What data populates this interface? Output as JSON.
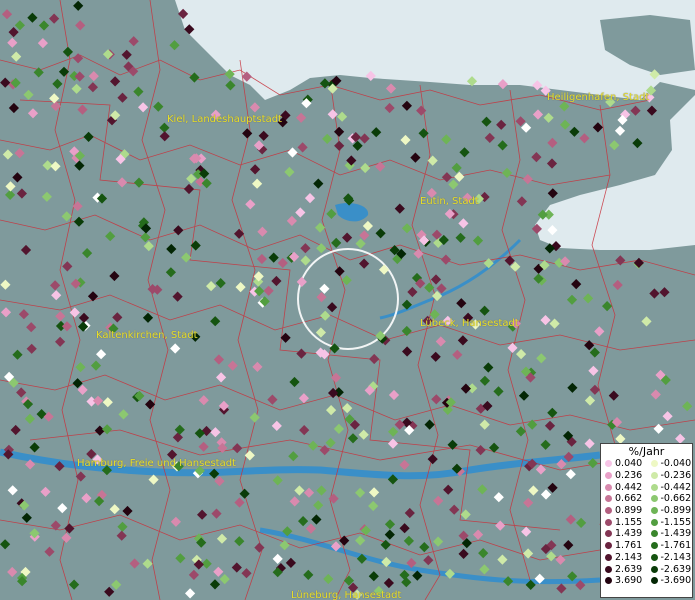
{
  "map": {
    "cities": [
      "Kiel, Landeshauptstadt",
      "Heiligenhafen, Stadt",
      "Eutin, Stadt",
      "Kaltenkirchen, Stadt",
      "Lübeck, Hansestadt",
      "Hamburg, Freie und Hansestadt",
      "Lüneburg, Hansestadt"
    ],
    "colors": {
      "land": "#7f9a9c",
      "sea": "#dfeaee",
      "river": "#3a8fc8",
      "borders": "#c8323c",
      "labels": "#e8e02a"
    }
  },
  "legend": {
    "title": "%/Jahr",
    "positive": [
      {
        "value": "0.040",
        "color": "#f7c4e6"
      },
      {
        "value": "0.236",
        "color": "#e9a0c8"
      },
      {
        "value": "0.442",
        "color": "#d98aae"
      },
      {
        "value": "0.662",
        "color": "#c77596"
      },
      {
        "value": "0.899",
        "color": "#b45f80"
      },
      {
        "value": "1.155",
        "color": "#9c4a6a"
      },
      {
        "value": "1.439",
        "color": "#833654"
      },
      {
        "value": "1.761",
        "color": "#6a2440"
      },
      {
        "value": "2.143",
        "color": "#52152e"
      },
      {
        "value": "2.639",
        "color": "#3a0a1e"
      },
      {
        "value": "3.690",
        "color": "#240410"
      }
    ],
    "negative": [
      {
        "value": "-0.040",
        "color": "#eef8c4"
      },
      {
        "value": "-0.236",
        "color": "#cfeaa8"
      },
      {
        "value": "-0.442",
        "color": "#aedb8c"
      },
      {
        "value": "-0.662",
        "color": "#8cc870"
      },
      {
        "value": "-0.899",
        "color": "#6eb456"
      },
      {
        "value": "-1.155",
        "color": "#529e40"
      },
      {
        "value": "-1.439",
        "color": "#3a862c"
      },
      {
        "value": "-1.761",
        "color": "#256c1c"
      },
      {
        "value": "-2.143",
        "color": "#155410"
      },
      {
        "value": "-2.639",
        "color": "#0a3c08"
      },
      {
        "value": "-3.690",
        "color": "#032604"
      }
    ]
  }
}
